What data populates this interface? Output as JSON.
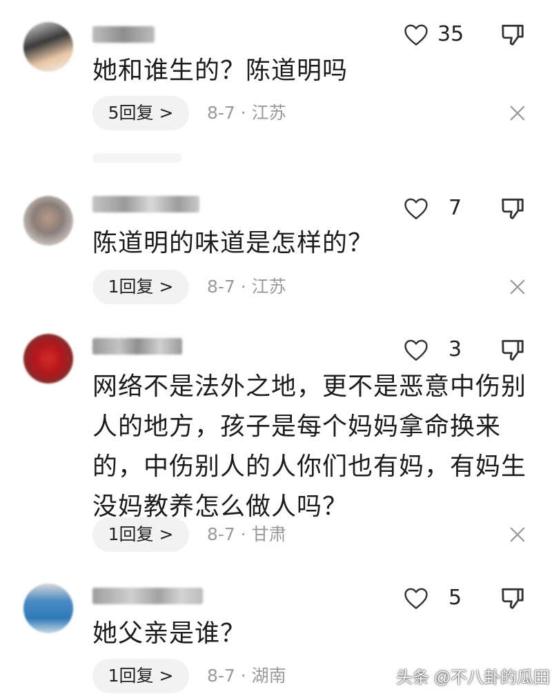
{
  "comments": [
    {
      "likes": "35",
      "text": "她和谁生的？陈道明吗",
      "replies": "5回复 >",
      "meta": "8-7 · 江苏"
    },
    {
      "likes": "7",
      "text": "陈道明的味道是怎样的？",
      "replies": "1回复 >",
      "meta": "8-7 · 江苏"
    },
    {
      "likes": "3",
      "text_lines": [
        "网络不是法外之地，更不是恶意中伤别",
        "人的地方，孩子是每个妈妈拿命换来",
        "的，中伤别人的人你们也有妈，有妈生",
        "没妈教养怎么做人吗？"
      ],
      "replies": "1回复 >",
      "meta": "8-7 · 甘肃"
    },
    {
      "likes": "5",
      "text": "她父亲是谁？",
      "replies": "1回复 >",
      "meta": "8-7 · 湖南"
    }
  ],
  "icons": {
    "like": "heart-outline-icon",
    "dislike": "thumbs-down-icon",
    "close": "close-icon"
  },
  "colors": {
    "meta_text": "#999999",
    "pill_bg": "#f2f2f2",
    "icon_stroke": "#333333"
  },
  "watermark": "头条 @不八卦的瓜田"
}
